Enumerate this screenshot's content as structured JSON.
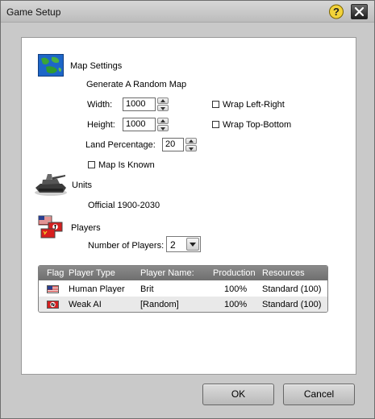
{
  "window": {
    "title": "Game Setup"
  },
  "map_settings": {
    "heading": "Map Settings",
    "generate_label": "Generate A Random Map",
    "width_label": "Width:",
    "width_value": "1000",
    "height_label": "Height:",
    "height_value": "1000",
    "wrap_lr_label": "Wrap Left-Right",
    "wrap_lr_checked": false,
    "wrap_tb_label": "Wrap Top-Bottom",
    "wrap_tb_checked": false,
    "land_label": "Land Percentage:",
    "land_value": "20",
    "known_label": "Map Is Known",
    "known_checked": false
  },
  "units": {
    "heading": "Units",
    "ruleset": "Official 1900-2030"
  },
  "players": {
    "heading": "Players",
    "count_label": "Number of Players:",
    "count_value": "2",
    "columns": [
      "Flag",
      "Player Type",
      "Player Name:",
      "Production",
      "Resources"
    ],
    "rows": [
      {
        "flag": "usa-flag-icon",
        "type": "Human Player",
        "name": "Brit",
        "production": "100%",
        "resources": "Standard (100)"
      },
      {
        "flag": "swastika-flag-icon",
        "type": "Weak AI",
        "name": "[Random]",
        "production": "100%",
        "resources": "Standard (100)"
      }
    ]
  },
  "buttons": {
    "ok": "OK",
    "cancel": "Cancel"
  },
  "colors": {
    "frame": "#c9c9c9",
    "panel": "#ffffff",
    "table_header": "#7a7a7a",
    "selected_row": "#e9e9e9"
  }
}
